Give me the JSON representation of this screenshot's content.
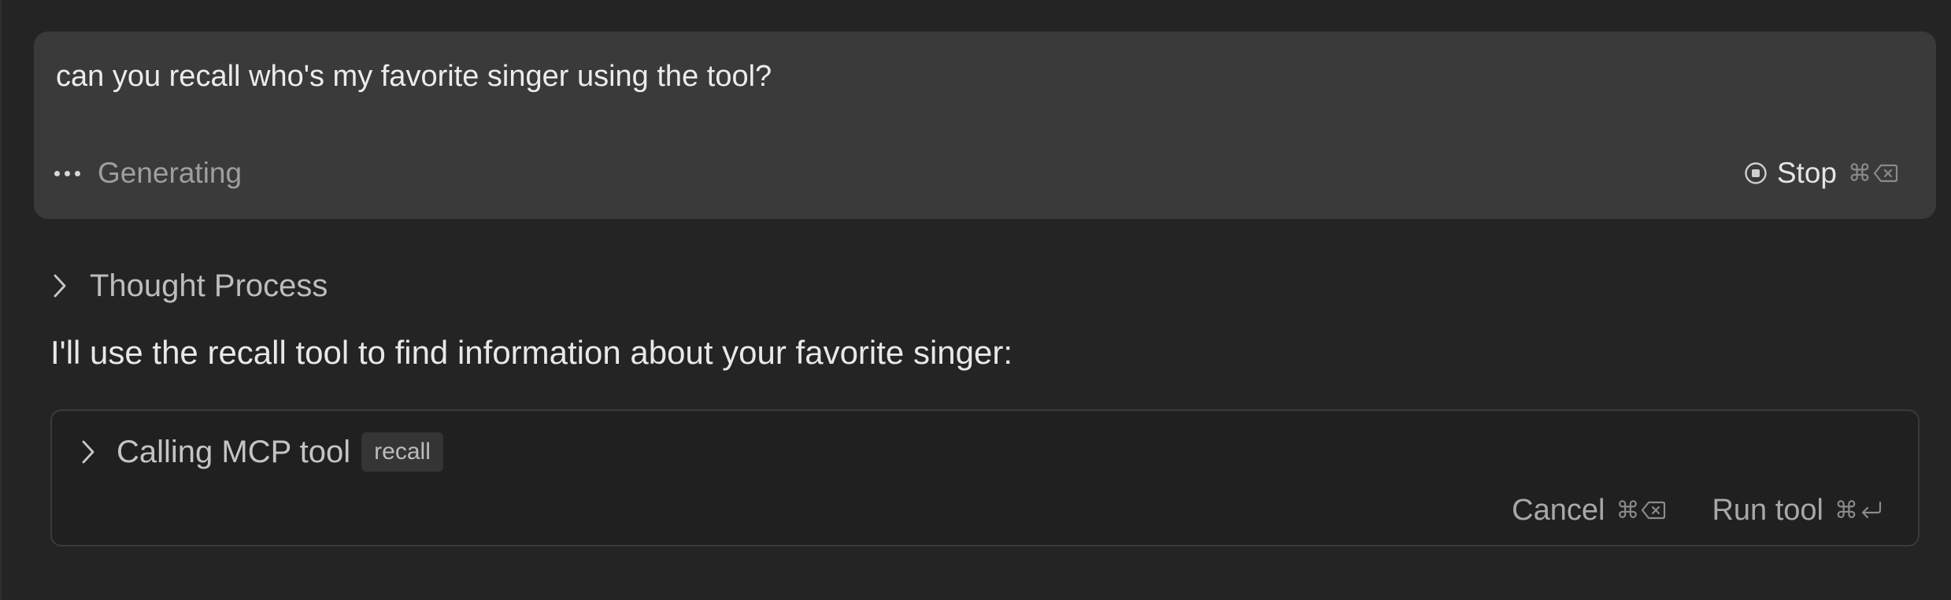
{
  "user_message": {
    "text": "can you recall who's my favorite singer using the tool?",
    "status": "Generating",
    "stop_label": "Stop",
    "stop_shortcut_key": "⌘"
  },
  "thought_process": {
    "label": "Thought Process"
  },
  "assistant": {
    "text": "I'll use the recall tool to find information about your favorite singer:"
  },
  "tool_call": {
    "label": "Calling MCP tool",
    "tool_name": "recall",
    "cancel_label": "Cancel",
    "cancel_shortcut_key": "⌘",
    "run_label": "Run tool",
    "run_shortcut_key": "⌘"
  },
  "icons": {
    "status": "ellipsis-icon",
    "stop": "stop-circle-icon",
    "delete": "delete-key-icon",
    "return": "return-key-icon",
    "chevron": "chevron-right-icon"
  }
}
